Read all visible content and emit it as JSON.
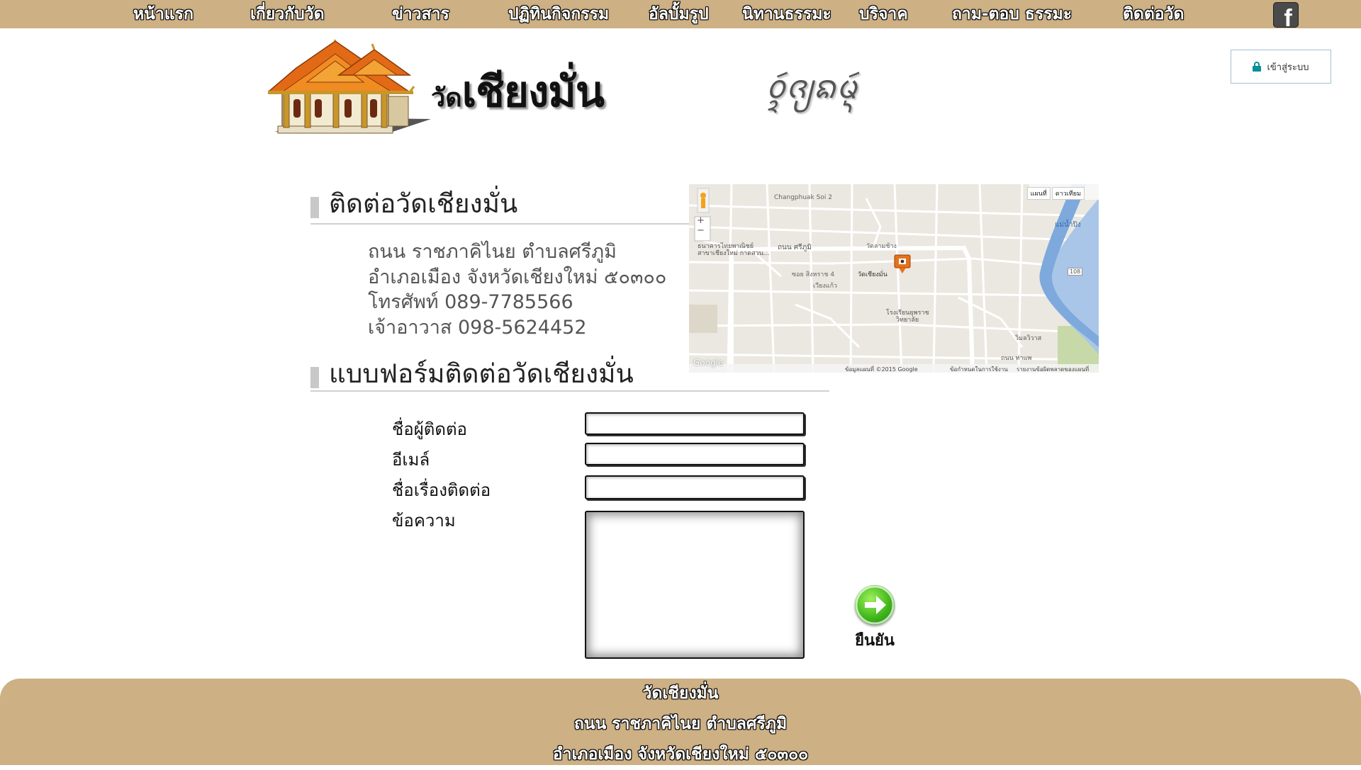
{
  "nav": {
    "items": [
      "หน้าแรก",
      "เกี่ยวกับวัด",
      "ข่าวสาร",
      "ปฏิทินกิจกรรม",
      "อัลบั้มรูป",
      "นิทานธรรมะ",
      "บริจาค",
      "ถาม-ตอบ ธรรมะ",
      "ติดต่อวัด"
    ],
    "facebook_glyph": "f"
  },
  "login": {
    "label": "เข้าสู่ระบบ",
    "icon": "lock-icon"
  },
  "header": {
    "title_prefix": "วัด",
    "title_main": "เชียงมั่น",
    "lanna_script": "ᩅᩢ᩠ᨯᨩ᩠ᨿᨦᨾᩢ᩠ᨶ"
  },
  "contact": {
    "heading": "ติดต่อวัดเชียงมั่น",
    "address_lines": [
      "ถนน ราชภาคิไนย ตำบลศรีภูมิ",
      "อำเภอเมือง จังหวัดเชียงใหม่ ๕๐๓๐๐",
      "โทรศัพท์ 089-7785566",
      "เจ้าอาวาส 098-5624452"
    ]
  },
  "map": {
    "type_buttons": [
      "แผนที่",
      "ดาวเทียม"
    ],
    "labels": {
      "road_top": "Changphuak Soi 2",
      "road_mid": "ถนน ศรีภูมิ",
      "bank": "ธนาคารไทยพาณิชย์",
      "bank2": "สาขาเชียงใหม่ กาดสวน...",
      "temple": "วัดเชียงมั่น",
      "school": "โรงเรียนยุพราช",
      "school2": "วิทยาลัย",
      "wat2": "วัดลามช้าง",
      "wiang": "เวียงแก้ว",
      "road_soi": "ซอย สิงหราช 4",
      "river": "แม่น้ำปิง",
      "road108": "108",
      "wimol": "วิมลวิวาส",
      "sala": "ถนน ท่าแพ",
      "copyright": "ข้อมูลแผนที่ ©2015 Google",
      "terms": "ข้อกำหนดในการใช้งาน",
      "report": "รายงานข้อผิดพลาดของแผนที่",
      "google": "Google"
    },
    "zoom_in": "+",
    "zoom_out": "−"
  },
  "form": {
    "heading": "แบบฟอร์มติดต่อวัดเชียงมั่น",
    "fields": {
      "name_label": "ชื่อผู้ติดต่อ",
      "email_label": "อีเมล์",
      "subject_label": "ชื่อเรื่องติดต่อ",
      "message_label": "ข้อความ"
    },
    "values": {
      "name": "",
      "email": "",
      "subject": "",
      "message": ""
    },
    "submit_label": "ยืนยัน"
  },
  "footer": {
    "lines": [
      "วัดเชียงมั่น",
      "ถนน ราชภาคิไนย ตำบลศรีภูมิ",
      "อำเภอเมือง จังหวัดเชียงใหม่ ๕๐๓๐๐"
    ]
  },
  "colors": {
    "nav_bg": "#cdb084",
    "footer_bg": "#cdb084",
    "accent": "#0b8f99"
  }
}
